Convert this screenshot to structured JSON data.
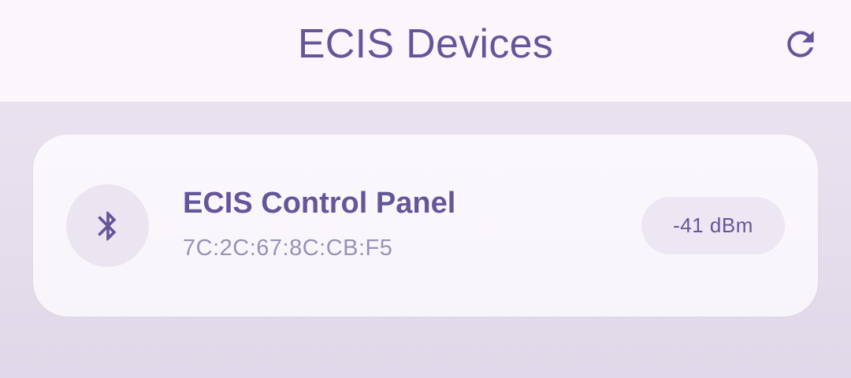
{
  "app_bar": {
    "title": "ECIS Devices",
    "refresh_icon": "refresh-icon"
  },
  "devices": [
    {
      "icon": "bluetooth-icon",
      "name": "ECIS Control Panel",
      "address": "7C:2C:67:8C:CB:F5",
      "rssi": "-41 dBm"
    }
  ],
  "colors": {
    "primary": "#67559a",
    "secondary_text": "#9a8fb8",
    "app_bar_bg": "#fbf6fc",
    "background": "#e7e0ee",
    "card_bg": "#faf7fc",
    "chip_bg": "#ede7f3"
  }
}
